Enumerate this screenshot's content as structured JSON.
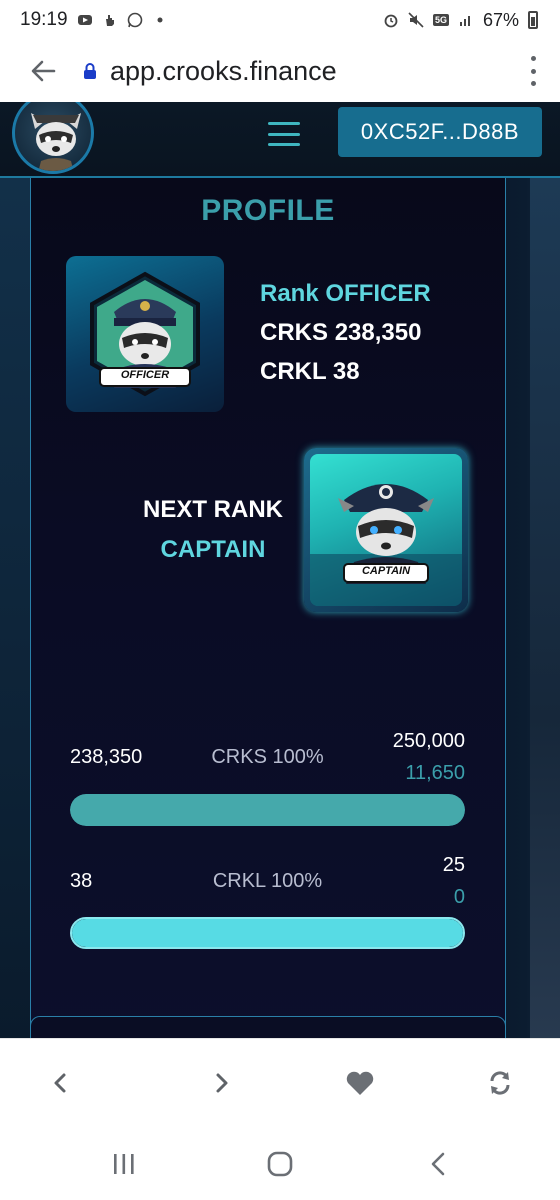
{
  "status_bar": {
    "time": "19:19",
    "network": "5G",
    "battery": "67%",
    "left_icons": [
      "youtube-icon",
      "hand-icon",
      "whatsapp-icon",
      "dot-icon"
    ],
    "right_icons": [
      "alarm-icon",
      "mute-icon",
      "signal-icon",
      "battery-icon"
    ]
  },
  "browser": {
    "url": "app.crooks.finance"
  },
  "navbar": {
    "wallet_address": "0XC52F...D88B"
  },
  "profile": {
    "title": "PROFILE",
    "rank_label": "Rank",
    "rank_value": "OFFICER",
    "crks_label": "CRKS",
    "crks_value": "238,350",
    "crkl_label": "CRKL",
    "crkl_value": "38",
    "rank_badge": "OFFICER",
    "next_rank_title": "NEXT RANK",
    "next_rank_name": "CAPTAIN",
    "next_badge": "CAPTAIN"
  },
  "progress": [
    {
      "current": "238,350",
      "label": "CRKS 100%",
      "target": "250,000",
      "remaining": "11,650",
      "fill": 1.0
    },
    {
      "current": "38",
      "label": "CRKL 100%",
      "target": "25",
      "remaining": "0",
      "fill": 1.0
    }
  ],
  "colors": {
    "accent_teal": "#3b9fab",
    "accent_cyan": "#5fd6df",
    "wallet_button": "#176d8f",
    "bar_crks": "#45a9ab",
    "bar_crkl": "#57dbe4"
  }
}
